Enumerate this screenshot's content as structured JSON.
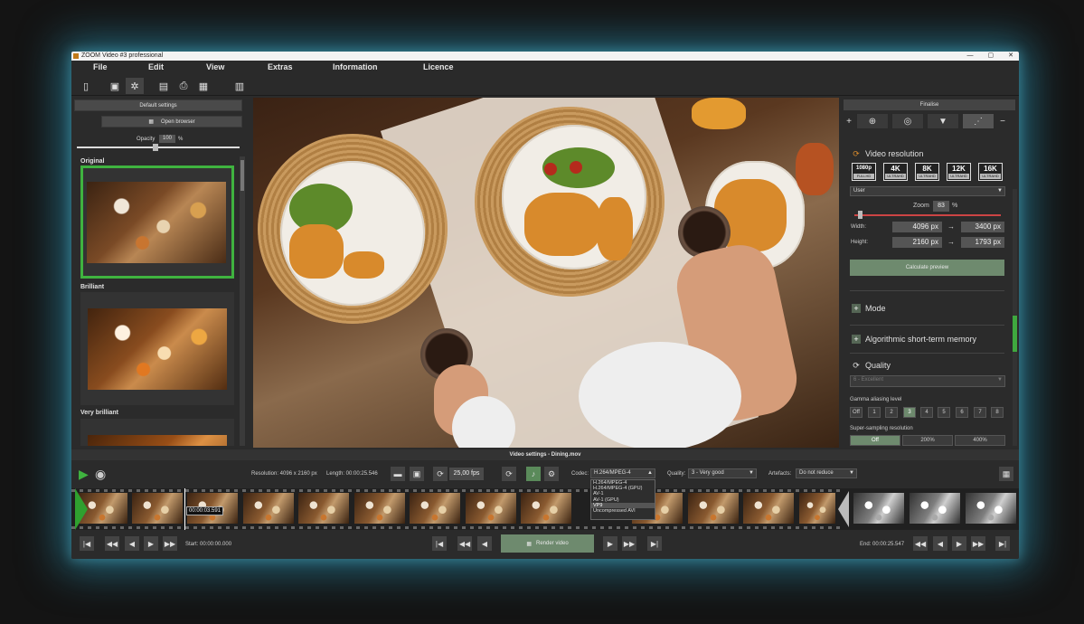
{
  "window": {
    "title": "ZOOM Video #3 professional",
    "minimize": "—",
    "maximize": "▢",
    "close": "✕"
  },
  "menu": [
    "File",
    "Edit",
    "View",
    "Extras",
    "Information",
    "Licence"
  ],
  "left": {
    "default_settings": "Default settings",
    "open_browser": "Open browser",
    "opacity_label": "Opacity",
    "opacity_value": "100",
    "opacity_unit": "%",
    "opacity_level": 0.5,
    "presets": [
      "Original",
      "Brilliant",
      "Very brilliant"
    ]
  },
  "right": {
    "finalise": "Finalise",
    "video_resolution_title": "Video resolution",
    "resolutions": [
      {
        "big": "1080p",
        "sub": "FULLHD"
      },
      {
        "big": "4K",
        "sub": "ULTRAHD"
      },
      {
        "big": "8K",
        "sub": "ULTRAHD"
      },
      {
        "big": "12K",
        "sub": "ULTRAHD"
      },
      {
        "big": "16K",
        "sub": "ULTRAHD"
      }
    ],
    "preset_select": "User",
    "zoom_label": "Zoom",
    "zoom_value": "83",
    "zoom_unit": "%",
    "width_label": "Width:",
    "width_from": "4096 px",
    "width_to": "3400 px",
    "height_label": "Height:",
    "height_from": "2160 px",
    "height_to": "1793 px",
    "arrow": "→",
    "calc_preview": "Calculate preview",
    "mode": "Mode",
    "memory": "Algorithmic short-term memory",
    "quality": "Quality",
    "quality_select": "6 - Excellent",
    "gamma_label": "Gamma aliasing level",
    "gamma_levels": [
      "Off",
      "1",
      "2",
      "3",
      "4",
      "5",
      "6",
      "7",
      "8"
    ],
    "gamma_selected": "3",
    "ss_label": "Super-sampling resolution",
    "ss_options": [
      "Off",
      "200%",
      "400%"
    ],
    "ss_selected": "Off"
  },
  "video_settings": {
    "title": "Video settings - Dining.mov",
    "resolution": "Resolution: 4096 x 2160 px",
    "length": "Length: 00:00:25.546",
    "fps": "25,00 fps",
    "codec_label": "Codec:",
    "codec_value": "H.264/MPEG-4",
    "codec_options": [
      "H.264/MPEG-4",
      "H.264/MPEG-4 (GPU)",
      "AV-1",
      "AV-1 (GPU)",
      "VP9",
      "Uncompressed AVI"
    ],
    "codec_highlight": "VP9",
    "quality_label": "Quality:",
    "quality_value": "3 - Very good",
    "artefacts_label": "Artefacts:",
    "artefacts_value": "Do not reduce"
  },
  "timeline": {
    "playhead_time": "00:00:03.591",
    "start": "Start: 00:00:00.000",
    "end": "End: 00:00:25.547",
    "render": "Render video"
  }
}
